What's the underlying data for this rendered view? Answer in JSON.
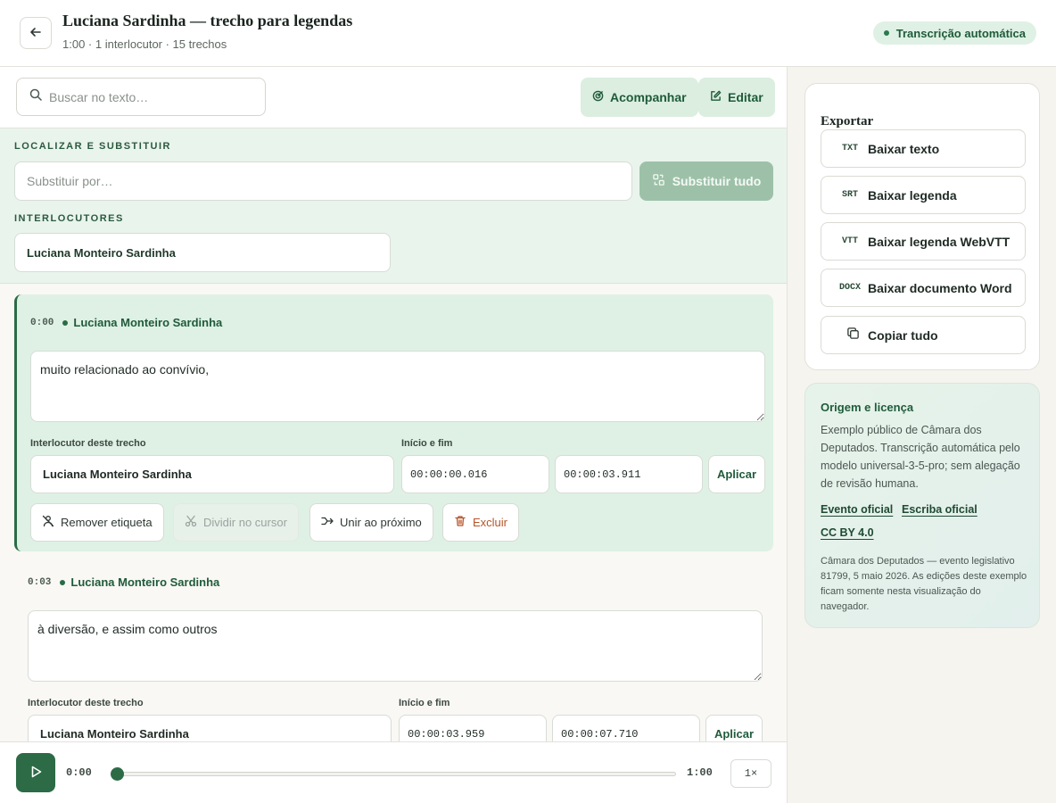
{
  "header": {
    "title": "Luciana Sardinha — trecho para legendas",
    "meta": "1:00 · 1 interlocutor · 15 trechos",
    "badge": "Transcrição automática"
  },
  "toolbar": {
    "search_placeholder": "Buscar no texto…",
    "follow_label": "Acompanhar",
    "edit_label": "Editar"
  },
  "find_replace": {
    "section_label": "LOCALIZAR E SUBSTITUIR",
    "replace_placeholder": "Substituir por…",
    "replace_all_label": "Substituir tudo",
    "speakers_label": "INTERLOCUTORES",
    "speakers": [
      "Luciana Monteiro Sardinha"
    ]
  },
  "segments": [
    {
      "time": "0:00",
      "speaker": "Luciana Monteiro Sardinha",
      "text": "muito relacionado ao convívio,",
      "speaker_field_label": "Interlocutor deste trecho",
      "speaker_value": "Luciana Monteiro Sardinha",
      "time_field_label": "Início e fim",
      "start": "00:00:00.016",
      "end": "00:00:03.911",
      "apply_label": "Aplicar",
      "actions": {
        "remove_label": "Remover etiqueta",
        "split_label": "Dividir no cursor",
        "merge_label": "Unir ao próximo",
        "delete_label": "Excluir"
      }
    },
    {
      "time": "0:03",
      "speaker": "Luciana Monteiro Sardinha",
      "text": "à diversão, e assim como outros",
      "speaker_field_label": "Interlocutor deste trecho",
      "speaker_value": "Luciana Monteiro Sardinha",
      "time_field_label": "Início e fim",
      "start": "00:00:03.959",
      "end": "00:00:07.710",
      "apply_label": "Aplicar"
    }
  ],
  "player": {
    "current": "0:00",
    "duration": "1:00",
    "speed": "1×",
    "progress": 0
  },
  "export": {
    "title": "Exportar",
    "items": [
      {
        "code": "TXT",
        "label": "Baixar texto"
      },
      {
        "code": "SRT",
        "label": "Baixar legenda"
      },
      {
        "code": "VTT",
        "label": "Baixar legenda WebVTT"
      },
      {
        "code": "DOCX",
        "label": "Baixar documento Word"
      },
      {
        "code": "copy-icon",
        "label": "Copiar tudo"
      }
    ]
  },
  "license": {
    "title": "Origem e licença",
    "text": "Exemplo público de Câmara dos Deputados. Transcrição automática pelo modelo universal-3-5-pro; sem alegação de revisão humana.",
    "links": [
      "Evento oficial",
      "Escriba oficial",
      "CC BY 4.0"
    ],
    "note": "Câmara dos Deputados — evento legislativo 81799, 5 maio 2026. As edições deste exemplo ficam somente nesta visualização do navegador."
  },
  "colors": {
    "accent": "#2c6b45",
    "accent_soft": "#dff1e4",
    "danger": "#b5542a"
  }
}
